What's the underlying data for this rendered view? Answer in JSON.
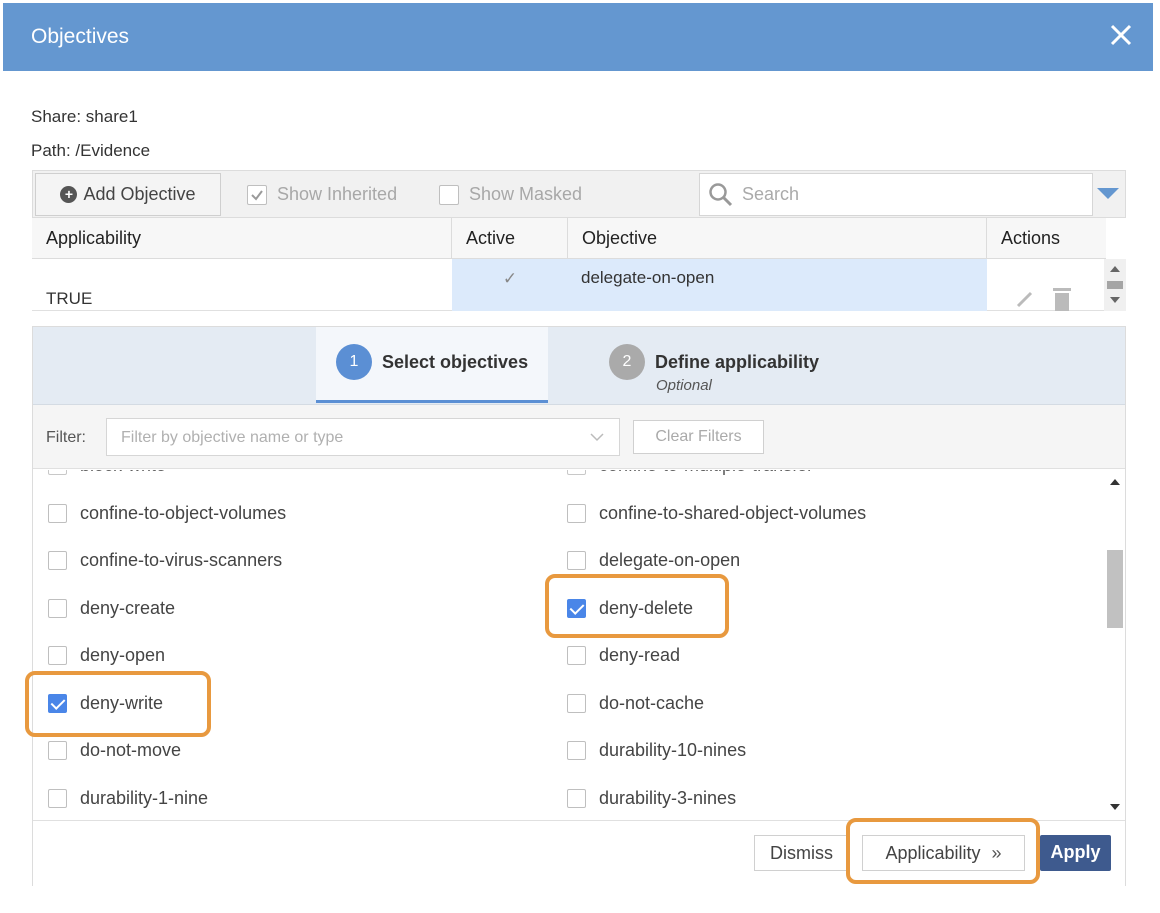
{
  "dialog": {
    "title": "Objectives"
  },
  "share": {
    "line1": "Share: share1",
    "line2": "Path: /Evidence"
  },
  "toolbar": {
    "add_label": "Add Objective",
    "show_inherited": "Show Inherited",
    "show_inherited_checked": true,
    "show_masked": "Show Masked",
    "show_masked_checked": false,
    "search_placeholder": "Search"
  },
  "grid": {
    "headers": [
      "Applicability",
      "Active",
      "Objective",
      "Actions"
    ],
    "row": {
      "applicability": "TRUE",
      "active": "✓",
      "objective": "delegate-on-open"
    }
  },
  "wizard": {
    "step1": {
      "num": "1",
      "label": "Select objectives"
    },
    "step2": {
      "num": "2",
      "label": "Define applicability",
      "sub": "Optional"
    }
  },
  "filter": {
    "label": "Filter:",
    "placeholder": "Filter by objective name or type",
    "clear": "Clear Filters"
  },
  "objectives": {
    "left": [
      {
        "label": "block-write",
        "checked": false
      },
      {
        "label": "confine-to-object-volumes",
        "checked": false
      },
      {
        "label": "confine-to-virus-scanners",
        "checked": false
      },
      {
        "label": "deny-create",
        "checked": false
      },
      {
        "label": "deny-open",
        "checked": false
      },
      {
        "label": "deny-write",
        "checked": true
      },
      {
        "label": "do-not-move",
        "checked": false
      },
      {
        "label": "durability-1-nine",
        "checked": false
      }
    ],
    "right": [
      {
        "label": "confine-to-multiple-transfer",
        "checked": false
      },
      {
        "label": "confine-to-shared-object-volumes",
        "checked": false
      },
      {
        "label": "delegate-on-open",
        "checked": false
      },
      {
        "label": "deny-delete",
        "checked": true
      },
      {
        "label": "deny-read",
        "checked": false
      },
      {
        "label": "do-not-cache",
        "checked": false
      },
      {
        "label": "durability-10-nines",
        "checked": false
      },
      {
        "label": "durability-3-nines",
        "checked": false
      }
    ]
  },
  "footer": {
    "dismiss": "Dismiss",
    "applicability": "Applicability",
    "apply": "Apply"
  },
  "colors": {
    "accent": "#6497d0",
    "highlight": "#e8993f",
    "apply_bg": "#3e5a8e"
  }
}
